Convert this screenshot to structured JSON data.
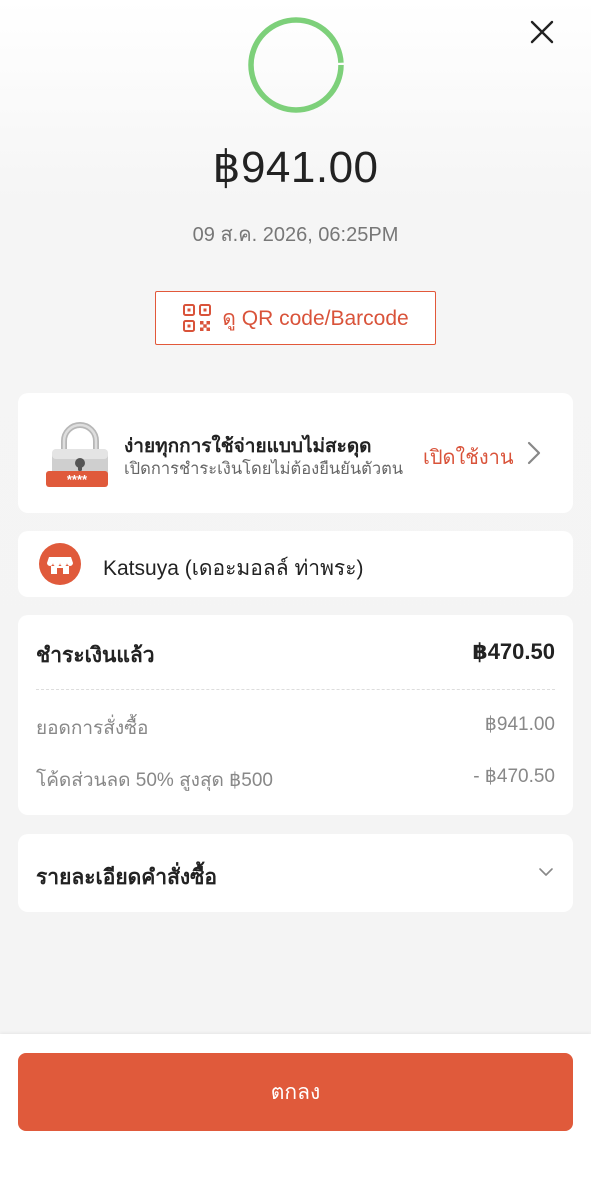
{
  "header": {
    "close_icon": "close-icon",
    "status_icon": "loading-ring-icon",
    "status_color": "#7dd07a"
  },
  "summary": {
    "amount": "฿941.00",
    "datetime": "09 ส.ค. 2026, 06:25PM",
    "qr_button_label": "ดู QR code/Barcode",
    "qr_icon": "qr-code-icon"
  },
  "promo": {
    "icon": "lock-icon",
    "title": "ง่ายทุกการใช้จ่ายแบบไม่สะดุด",
    "subtitle": "เปิดการชำระเงินโดยไม่ต้องยืนยันตัวตน",
    "action_label": "เปิดใช้งาน",
    "pin_mask": "****"
  },
  "shop": {
    "icon": "store-icon",
    "name": "Katsuya (เดอะมอลล์ ท่าพระ)"
  },
  "payment": {
    "paid_label": "ชำระเงินแล้ว",
    "paid_value": "฿470.50",
    "subtotal_label": "ยอดการสั่งซื้อ",
    "subtotal_value": "฿941.00",
    "discount_label": "โค้ดส่วนลด 50% สูงสุด ฿500",
    "discount_value": "- ฿470.50"
  },
  "details": {
    "title": "รายละเอียดคำสั่งซื้อ",
    "icon": "chevron-down-icon"
  },
  "footer": {
    "ok_label": "ตกลง"
  },
  "colors": {
    "accent": "#e05a3b",
    "success": "#7dd07a"
  }
}
